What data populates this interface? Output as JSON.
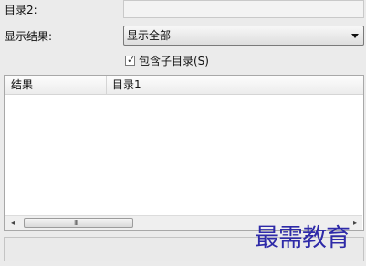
{
  "form": {
    "directory2_label": "目录2:",
    "directory2_value": "",
    "display_results_label": "显示结果:",
    "display_results_selected": "显示全部",
    "include_subdirs_label": "包含子目录(S)",
    "include_subdirs_checked": true,
    "checkbox_mark": "✓"
  },
  "results_list": {
    "columns": [
      "结果",
      "目录1"
    ],
    "rows": [],
    "scroll": {
      "left_arrow": "◂",
      "right_arrow": "▸",
      "grip": "III"
    }
  },
  "status_bar": {
    "text": ""
  },
  "watermark": "最需教育"
}
